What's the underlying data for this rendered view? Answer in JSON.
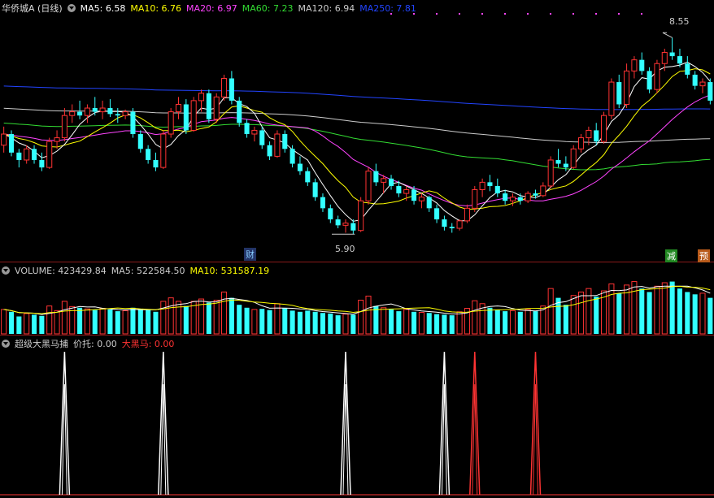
{
  "price_legend": {
    "title": "华侨城A (日线)",
    "items": [
      {
        "label": "MA5: 6.58",
        "color": "#ffffff"
      },
      {
        "label": "MA10: 6.76",
        "color": "#ffff00"
      },
      {
        "label": "MA20: 6.97",
        "color": "#ff44ff"
      },
      {
        "label": "MA60: 7.23",
        "color": "#33dd33"
      },
      {
        "label": "MA120: 6.94",
        "color": "#cccccc"
      },
      {
        "label": "MA250: 7.81",
        "color": "#2244ff"
      }
    ]
  },
  "volume_legend": {
    "items": [
      {
        "label": "VOLUME: 423429.84",
        "color": "#cccccc"
      },
      {
        "label": "MA5: 522584.50",
        "color": "#cccccc"
      },
      {
        "label": "MA10: 531587.19",
        "color": "#ffff00"
      }
    ]
  },
  "indicator_legend": {
    "items": [
      {
        "label": "超级大黑马捕",
        "color": "#cccccc"
      },
      {
        "label": "价托: 0.00",
        "color": "#cccccc"
      },
      {
        "label": "大黑马: 0.00",
        "color": "#ff3333"
      }
    ]
  },
  "annotations": {
    "high": "8.55",
    "low": "5.90",
    "tag_cai": "财",
    "tag_jian": "减",
    "tag_yu": "预"
  },
  "colors": {
    "up": "#ff3333",
    "down": "#33ffff",
    "ma5": "#ffffff",
    "ma10": "#ffff00",
    "ma20": "#ff44ff",
    "ma60": "#33dd33",
    "ma120": "#cccccc",
    "ma250": "#2244ff"
  },
  "chart_data": {
    "type": "candlestick",
    "y_range": [
      5.9,
      8.55
    ],
    "candles": [
      [
        7.1,
        7.35,
        7.0,
        7.25
      ],
      [
        7.25,
        7.3,
        6.95,
        7.0
      ],
      [
        7.0,
        7.05,
        6.8,
        6.9
      ],
      [
        6.9,
        7.1,
        6.85,
        7.05
      ],
      [
        7.05,
        7.1,
        6.85,
        6.9
      ],
      [
        6.9,
        7.0,
        6.75,
        6.8
      ],
      [
        6.8,
        7.2,
        6.78,
        7.15
      ],
      [
        7.15,
        7.3,
        7.05,
        7.2
      ],
      [
        7.2,
        7.6,
        7.15,
        7.5
      ],
      [
        7.5,
        7.65,
        7.4,
        7.55
      ],
      [
        7.55,
        7.7,
        7.45,
        7.5
      ],
      [
        7.5,
        7.65,
        7.4,
        7.6
      ],
      [
        7.6,
        7.75,
        7.5,
        7.55
      ],
      [
        7.55,
        7.7,
        7.45,
        7.6
      ],
      [
        7.6,
        7.72,
        7.48,
        7.52
      ],
      [
        7.52,
        7.6,
        7.4,
        7.5
      ],
      [
        7.5,
        7.58,
        7.45,
        7.55
      ],
      [
        7.55,
        7.6,
        7.2,
        7.25
      ],
      [
        7.25,
        7.3,
        7.0,
        7.05
      ],
      [
        7.05,
        7.1,
        6.85,
        6.9
      ],
      [
        6.9,
        7.0,
        6.75,
        6.8
      ],
      [
        6.8,
        7.3,
        6.78,
        7.25
      ],
      [
        7.25,
        7.6,
        7.2,
        7.55
      ],
      [
        7.55,
        7.75,
        7.45,
        7.65
      ],
      [
        7.65,
        7.72,
        7.25,
        7.3
      ],
      [
        7.3,
        7.75,
        7.28,
        7.7
      ],
      [
        7.7,
        7.85,
        7.55,
        7.8
      ],
      [
        7.8,
        7.85,
        7.4,
        7.45
      ],
      [
        7.45,
        7.8,
        7.4,
        7.75
      ],
      [
        7.75,
        8.05,
        7.7,
        8.0
      ],
      [
        8.0,
        8.1,
        7.65,
        7.7
      ],
      [
        7.7,
        7.75,
        7.35,
        7.4
      ],
      [
        7.4,
        7.45,
        7.2,
        7.25
      ],
      [
        7.25,
        7.35,
        7.15,
        7.3
      ],
      [
        7.3,
        7.35,
        7.05,
        7.1
      ],
      [
        7.1,
        7.15,
        6.9,
        6.95
      ],
      [
        6.95,
        7.3,
        6.93,
        7.25
      ],
      [
        7.25,
        7.3,
        7.0,
        7.05
      ],
      [
        7.05,
        7.1,
        6.8,
        6.85
      ],
      [
        6.85,
        6.95,
        6.7,
        6.75
      ],
      [
        6.75,
        6.8,
        6.55,
        6.6
      ],
      [
        6.6,
        6.65,
        6.35,
        6.4
      ],
      [
        6.4,
        6.45,
        6.2,
        6.25
      ],
      [
        6.25,
        6.3,
        6.05,
        6.1
      ],
      [
        6.1,
        6.15,
        5.98,
        6.02
      ],
      [
        6.02,
        6.1,
        5.92,
        6.05
      ],
      [
        6.05,
        6.1,
        5.9,
        5.95
      ],
      [
        5.95,
        6.4,
        5.93,
        6.35
      ],
      [
        6.35,
        6.8,
        6.3,
        6.75
      ],
      [
        6.75,
        6.85,
        6.55,
        6.6
      ],
      [
        6.6,
        6.7,
        6.45,
        6.65
      ],
      [
        6.65,
        6.7,
        6.5,
        6.55
      ],
      [
        6.55,
        6.62,
        6.4,
        6.45
      ],
      [
        6.45,
        6.55,
        6.35,
        6.5
      ],
      [
        6.5,
        6.55,
        6.3,
        6.35
      ],
      [
        6.35,
        6.45,
        6.25,
        6.4
      ],
      [
        6.4,
        6.42,
        6.2,
        6.25
      ],
      [
        6.25,
        6.3,
        6.05,
        6.1
      ],
      [
        6.1,
        6.15,
        5.95,
        6.0
      ],
      [
        6.0,
        6.05,
        5.92,
        5.98
      ],
      [
        5.98,
        6.1,
        5.95,
        6.08
      ],
      [
        6.08,
        6.3,
        6.05,
        6.25
      ],
      [
        6.25,
        6.55,
        6.2,
        6.5
      ],
      [
        6.5,
        6.65,
        6.4,
        6.6
      ],
      [
        6.6,
        6.7,
        6.48,
        6.55
      ],
      [
        6.55,
        6.65,
        6.4,
        6.45
      ],
      [
        6.45,
        6.5,
        6.3,
        6.35
      ],
      [
        6.35,
        6.45,
        6.28,
        6.4
      ],
      [
        6.4,
        6.45,
        6.3,
        6.35
      ],
      [
        6.35,
        6.48,
        6.32,
        6.45
      ],
      [
        6.45,
        6.5,
        6.38,
        6.42
      ],
      [
        6.42,
        6.6,
        6.4,
        6.55
      ],
      [
        6.55,
        6.95,
        6.52,
        6.9
      ],
      [
        6.9,
        7.05,
        6.8,
        6.85
      ],
      [
        6.85,
        6.95,
        6.75,
        6.8
      ],
      [
        6.8,
        7.1,
        6.78,
        7.05
      ],
      [
        7.05,
        7.25,
        7.0,
        7.2
      ],
      [
        7.2,
        7.35,
        7.1,
        7.3
      ],
      [
        7.3,
        7.4,
        7.1,
        7.15
      ],
      [
        7.15,
        7.55,
        7.12,
        7.5
      ],
      [
        7.5,
        8.0,
        7.45,
        7.95
      ],
      [
        7.95,
        8.05,
        7.6,
        7.65
      ],
      [
        7.65,
        8.2,
        7.6,
        8.1
      ],
      [
        8.1,
        8.3,
        8.0,
        8.25
      ],
      [
        8.25,
        8.35,
        8.05,
        8.1
      ],
      [
        8.1,
        8.15,
        7.8,
        7.85
      ],
      [
        7.85,
        8.25,
        7.8,
        8.2
      ],
      [
        8.2,
        8.4,
        8.1,
        8.35
      ],
      [
        8.35,
        8.55,
        8.25,
        8.3
      ],
      [
        8.3,
        8.4,
        8.15,
        8.2
      ],
      [
        8.2,
        8.3,
        8.0,
        8.05
      ],
      [
        8.05,
        8.1,
        7.85,
        7.9
      ],
      [
        7.9,
        8.0,
        7.8,
        7.95
      ],
      [
        7.95,
        8.0,
        7.65,
        7.7
      ]
    ],
    "volumes": [
      420,
      380,
      300,
      350,
      330,
      310,
      480,
      400,
      560,
      470,
      450,
      430,
      410,
      440,
      420,
      390,
      400,
      450,
      430,
      410,
      380,
      560,
      620,
      560,
      480,
      560,
      600,
      540,
      580,
      720,
      620,
      500,
      450,
      420,
      430,
      410,
      520,
      440,
      400,
      380,
      400,
      380,
      360,
      350,
      320,
      340,
      330,
      580,
      650,
      480,
      450,
      420,
      390,
      420,
      380,
      370,
      360,
      340,
      330,
      320,
      380,
      440,
      570,
      520,
      450,
      420,
      390,
      400,
      380,
      420,
      390,
      480,
      780,
      620,
      500,
      660,
      720,
      780,
      640,
      740,
      860,
      700,
      840,
      900,
      780,
      720,
      820,
      880,
      900,
      780,
      720,
      680,
      700,
      620
    ],
    "signals": {
      "white": [
        8,
        21,
        45,
        58
      ],
      "red": [
        62,
        70
      ]
    }
  }
}
